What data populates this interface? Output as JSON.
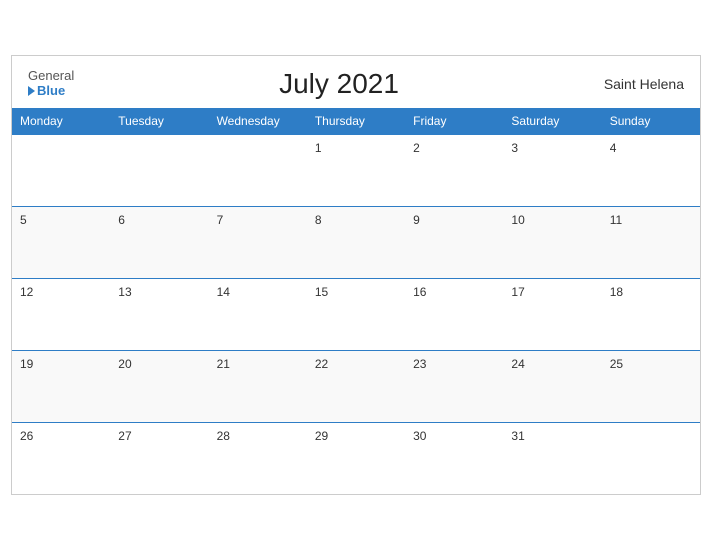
{
  "header": {
    "logo_general": "General",
    "logo_blue": "Blue",
    "title": "July 2021",
    "region": "Saint Helena"
  },
  "weekdays": [
    "Monday",
    "Tuesday",
    "Wednesday",
    "Thursday",
    "Friday",
    "Saturday",
    "Sunday"
  ],
  "weeks": [
    [
      "",
      "",
      "",
      "1",
      "2",
      "3",
      "4"
    ],
    [
      "5",
      "6",
      "7",
      "8",
      "9",
      "10",
      "11"
    ],
    [
      "12",
      "13",
      "14",
      "15",
      "16",
      "17",
      "18"
    ],
    [
      "19",
      "20",
      "21",
      "22",
      "23",
      "24",
      "25"
    ],
    [
      "26",
      "27",
      "28",
      "29",
      "30",
      "31",
      ""
    ]
  ],
  "colors": {
    "accent": "#2e7dc6"
  }
}
